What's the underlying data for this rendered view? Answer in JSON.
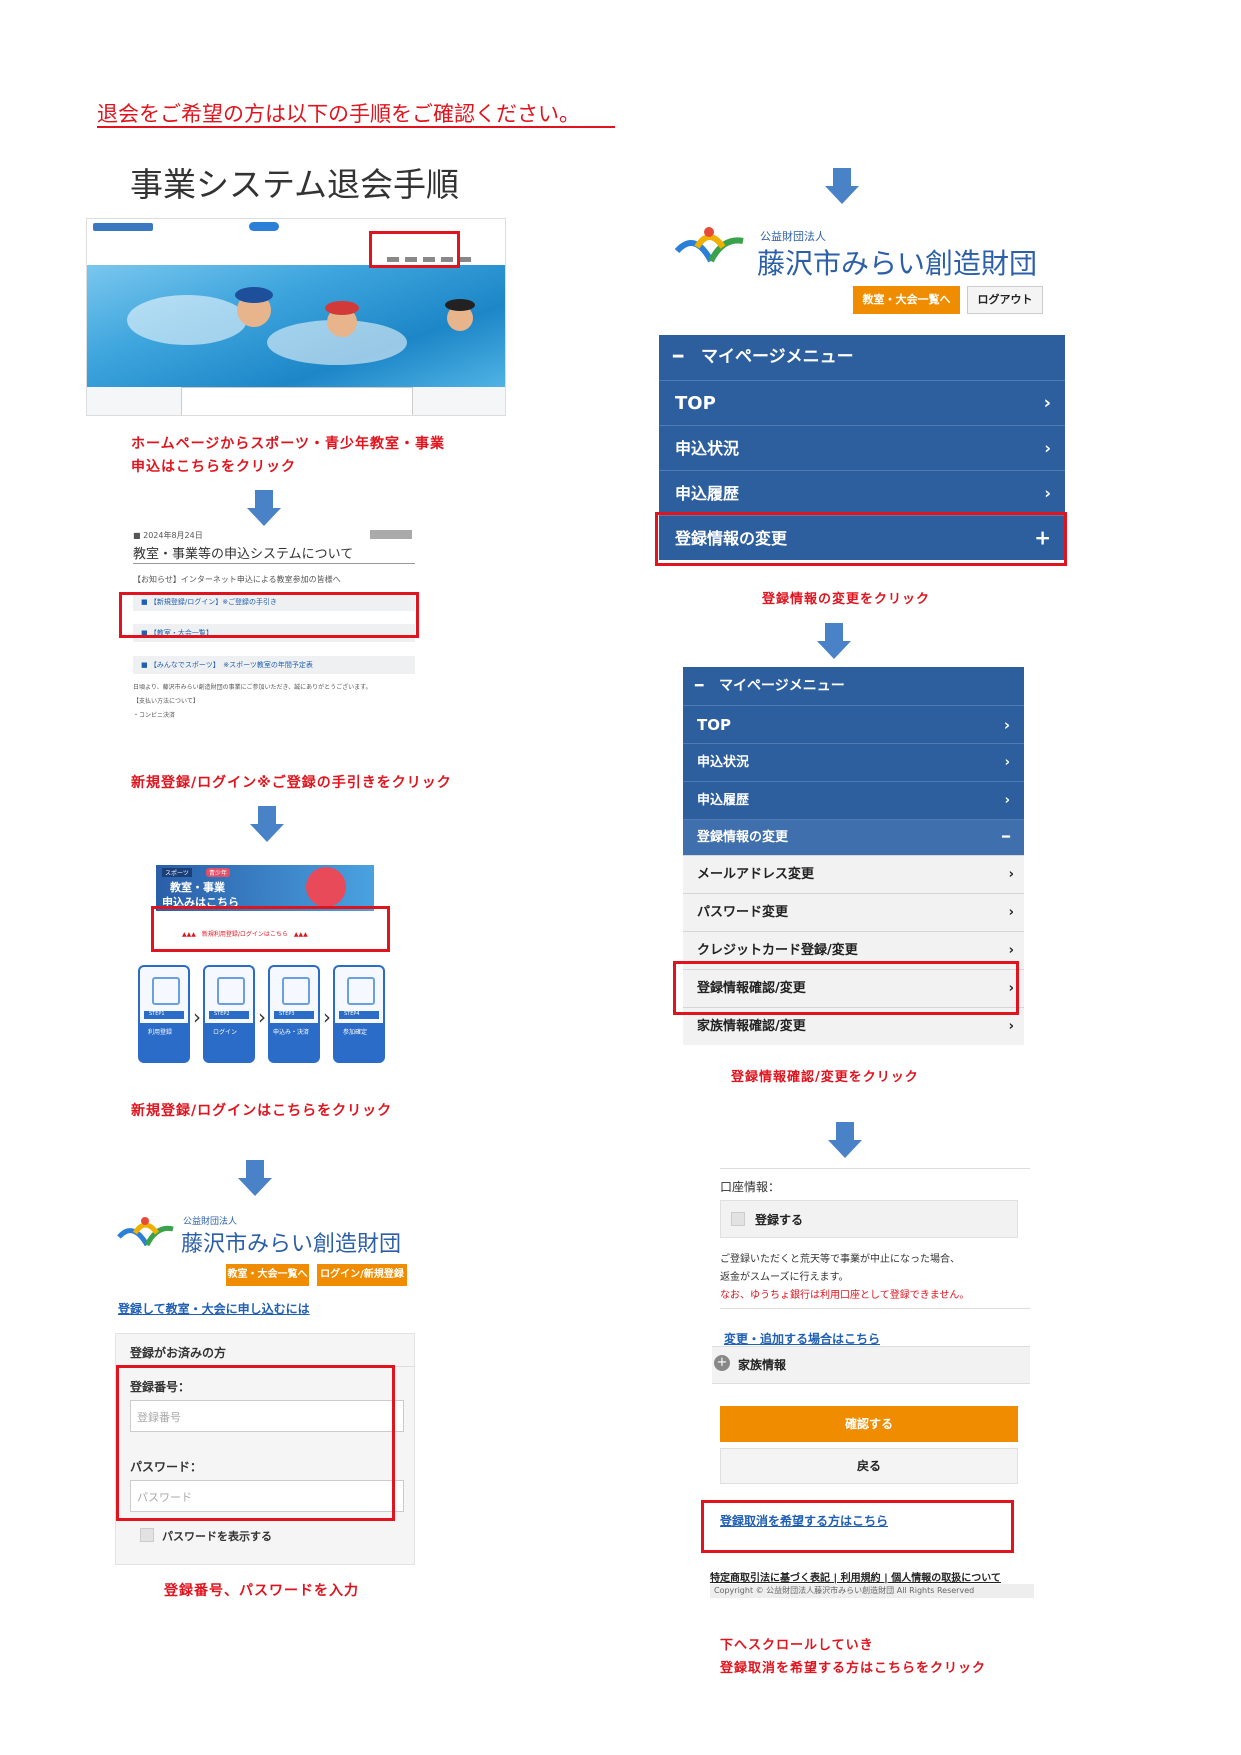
{
  "headline": "退会をご希望の方は以下の手順をご確認ください。",
  "title": "事業システム退会手順",
  "step1": {
    "caption_line1": "ホームページからスポーツ・青少年教室・事業",
    "caption_line2": "申込はこちらをクリック"
  },
  "step2": {
    "date": "■ 2024年8月24日",
    "heading": "教室・事業等の申込システムについて",
    "notice": "【お知らせ】インターネット申込による教室参加の皆様へ",
    "item1": "■ 【新規登録/ログイン】※ご登録の手引き",
    "item2": "■ 【教室・大会一覧】",
    "item3": "■ 【みんなでスポーツ】　※スポーツ教室の年間予定表",
    "body": "日頃より、藤沢市みらい創造財団の事業にご参加いただき、誠にありがとうございます。",
    "sub_heading": "【支払い方法について】",
    "sub_item": "・コンビニ決済",
    "caption": "新規登録/ログイン※ご登録の手引きをクリック"
  },
  "step3": {
    "tag1": "スポーツ",
    "tag2": "青少年",
    "banner_line1": "教室・事業",
    "banner_line2": "申込みはこちら",
    "login_link": "▲▲▲　新規利用登録/ログインはこちら　▲▲▲",
    "steps": [
      {
        "num": "STEP1",
        "name": "利用登録"
      },
      {
        "num": "STEP2",
        "name": "ログイン"
      },
      {
        "num": "STEP3",
        "name": "申込み・決済"
      },
      {
        "num": "STEP4",
        "name": "参加確定"
      }
    ],
    "caption": "新規登録/ログインはこちらをクリック"
  },
  "logo": {
    "sub": "公益財団法人",
    "main": "藤沢市みらい創造財団"
  },
  "login_page": {
    "btn_list": "教室・大会一覧へ",
    "btn_login": "ログイン/新規登録",
    "apply_link": "登録して教室・大会に申し込むには",
    "panel_title": "登録がお済みの方",
    "reg_label": "登録番号：",
    "reg_placeholder": "登録番号",
    "pw_label": "パスワード：",
    "pw_placeholder": "パスワード",
    "show_pw": "パスワードを表示する",
    "caption": "登録番号、パスワードを入力"
  },
  "mypage": {
    "btn_list": "教室・大会一覧へ",
    "btn_logout": "ログアウト",
    "menu_title": "マイページメニュー",
    "items": [
      "TOP",
      "申込状況",
      "申込履歴",
      "登録情報の変更"
    ],
    "caption": "登録情報の変更をクリック"
  },
  "submenu": {
    "menu_title": "マイページメニュー",
    "items": [
      "TOP",
      "申込状況",
      "申込履歴",
      "登録情報の変更"
    ],
    "sub_items": [
      "メールアドレス変更",
      "パスワード変更",
      "クレジットカード登録/変更",
      "登録情報確認/変更",
      "家族情報確認/変更"
    ],
    "caption": "登録情報確認/変更をクリック"
  },
  "account": {
    "label": "口座情報：",
    "register": "登録する",
    "note1": "ご登録いただくと荒天等で事業が中止になった場合、",
    "note2": "返金がスムーズに行えます。",
    "note3": "なお、ゆうちょ銀行は利用口座として登録できません。",
    "change_link": "変更・追加する場合はこちら",
    "family": "家族情報",
    "confirm": "確認する",
    "back": "戻る",
    "cancel_link": "登録取消を希望する方はこちら",
    "footer_links": "特定商取引法に基づく表記 | 利用規約 | 個人情報の取扱について",
    "copyright": "Copyright © 公益財団法人藤沢市みらい創造財団 All Rights Reserved",
    "caption_line1": "下へスクロールしていき",
    "caption_line2": "登録取消を希望する方はこちらをクリック"
  },
  "colors": {
    "accent_red": "#e0141e",
    "menu_blue": "#2d5f9e",
    "button_orange": "#f08c00",
    "arrow_blue": "#4a82c8"
  }
}
